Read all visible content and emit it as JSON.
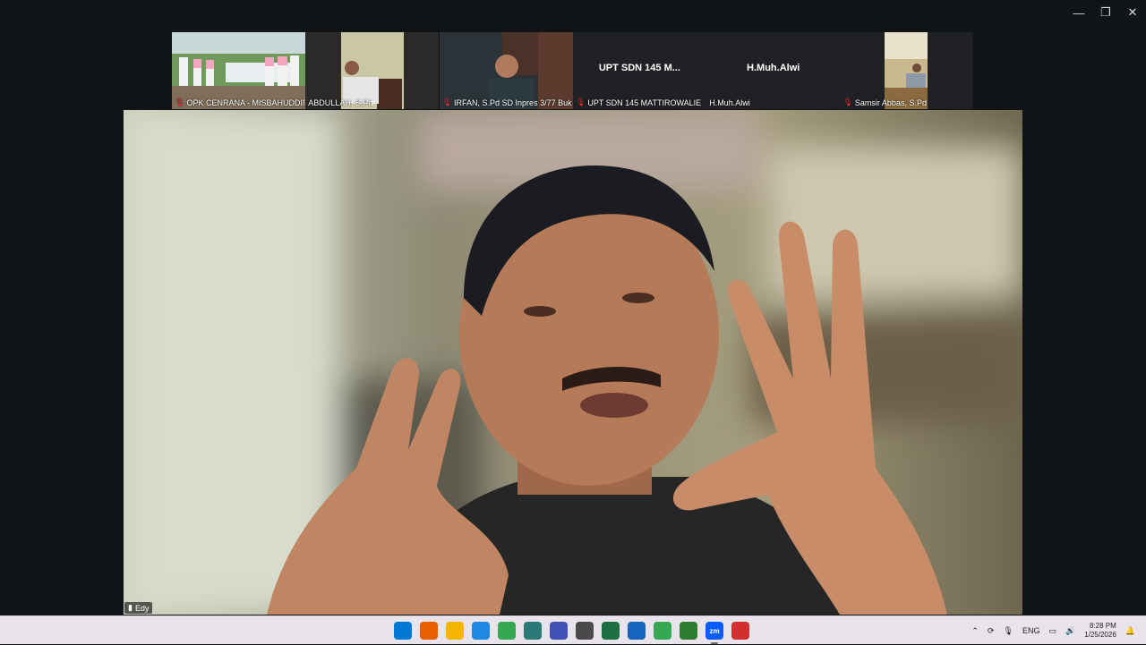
{
  "window": {
    "controls": {
      "minimize": "—",
      "restore": "❐",
      "close": "✕"
    }
  },
  "participants": [
    {
      "name": "OPK CENRANA - MISBAHUDDIN",
      "muted": true,
      "has_video": true
    },
    {
      "name": "ABDULLAH, S.Pd",
      "muted": false,
      "has_video": true
    },
    {
      "name": "IRFAN, S.Pd SD Inpres 3/77 Buka...",
      "muted": true,
      "has_video": true
    },
    {
      "name": "UPT SDN 145 MATTIROWALIE",
      "display_big": "UPT SDN 145 M...",
      "muted": true,
      "has_video": false
    },
    {
      "name": "H.Muh.Alwi",
      "display_big": "H.Muh.Alwi",
      "muted": false,
      "has_video": false
    },
    {
      "name": "Samsir Abbas, S.Pd",
      "muted": true,
      "has_video": true
    }
  ],
  "active_speaker": {
    "name": "Edy",
    "signal_icon": "signal-bars-icon"
  },
  "taskbar": {
    "apps": [
      {
        "name": "windows-start-icon",
        "color": "#0078d4"
      },
      {
        "name": "firefox-icon",
        "color": "#e66000"
      },
      {
        "name": "file-explorer-icon",
        "color": "#f4b400"
      },
      {
        "name": "notepad-icon",
        "color": "#1e88e5"
      },
      {
        "name": "chrome-icon",
        "color": "#34a853"
      },
      {
        "name": "edge-icon",
        "color": "#2b7a78"
      },
      {
        "name": "network-icon",
        "color": "#3f51b5"
      },
      {
        "name": "calculator-icon",
        "color": "#4a4a4a"
      },
      {
        "name": "excel-icon",
        "color": "#1d6f42"
      },
      {
        "name": "browser-icon",
        "color": "#1565c0"
      },
      {
        "name": "chrome-profile-icon",
        "color": "#34a853"
      },
      {
        "name": "globe-icon",
        "color": "#2e7d32"
      },
      {
        "name": "zoom-icon",
        "color": "#0b5cff",
        "label": "zm"
      },
      {
        "name": "record-icon",
        "color": "#d32f2f"
      }
    ],
    "tray": {
      "language": "ENG",
      "time": "8:28 PM",
      "date": "1/25/2026"
    }
  }
}
